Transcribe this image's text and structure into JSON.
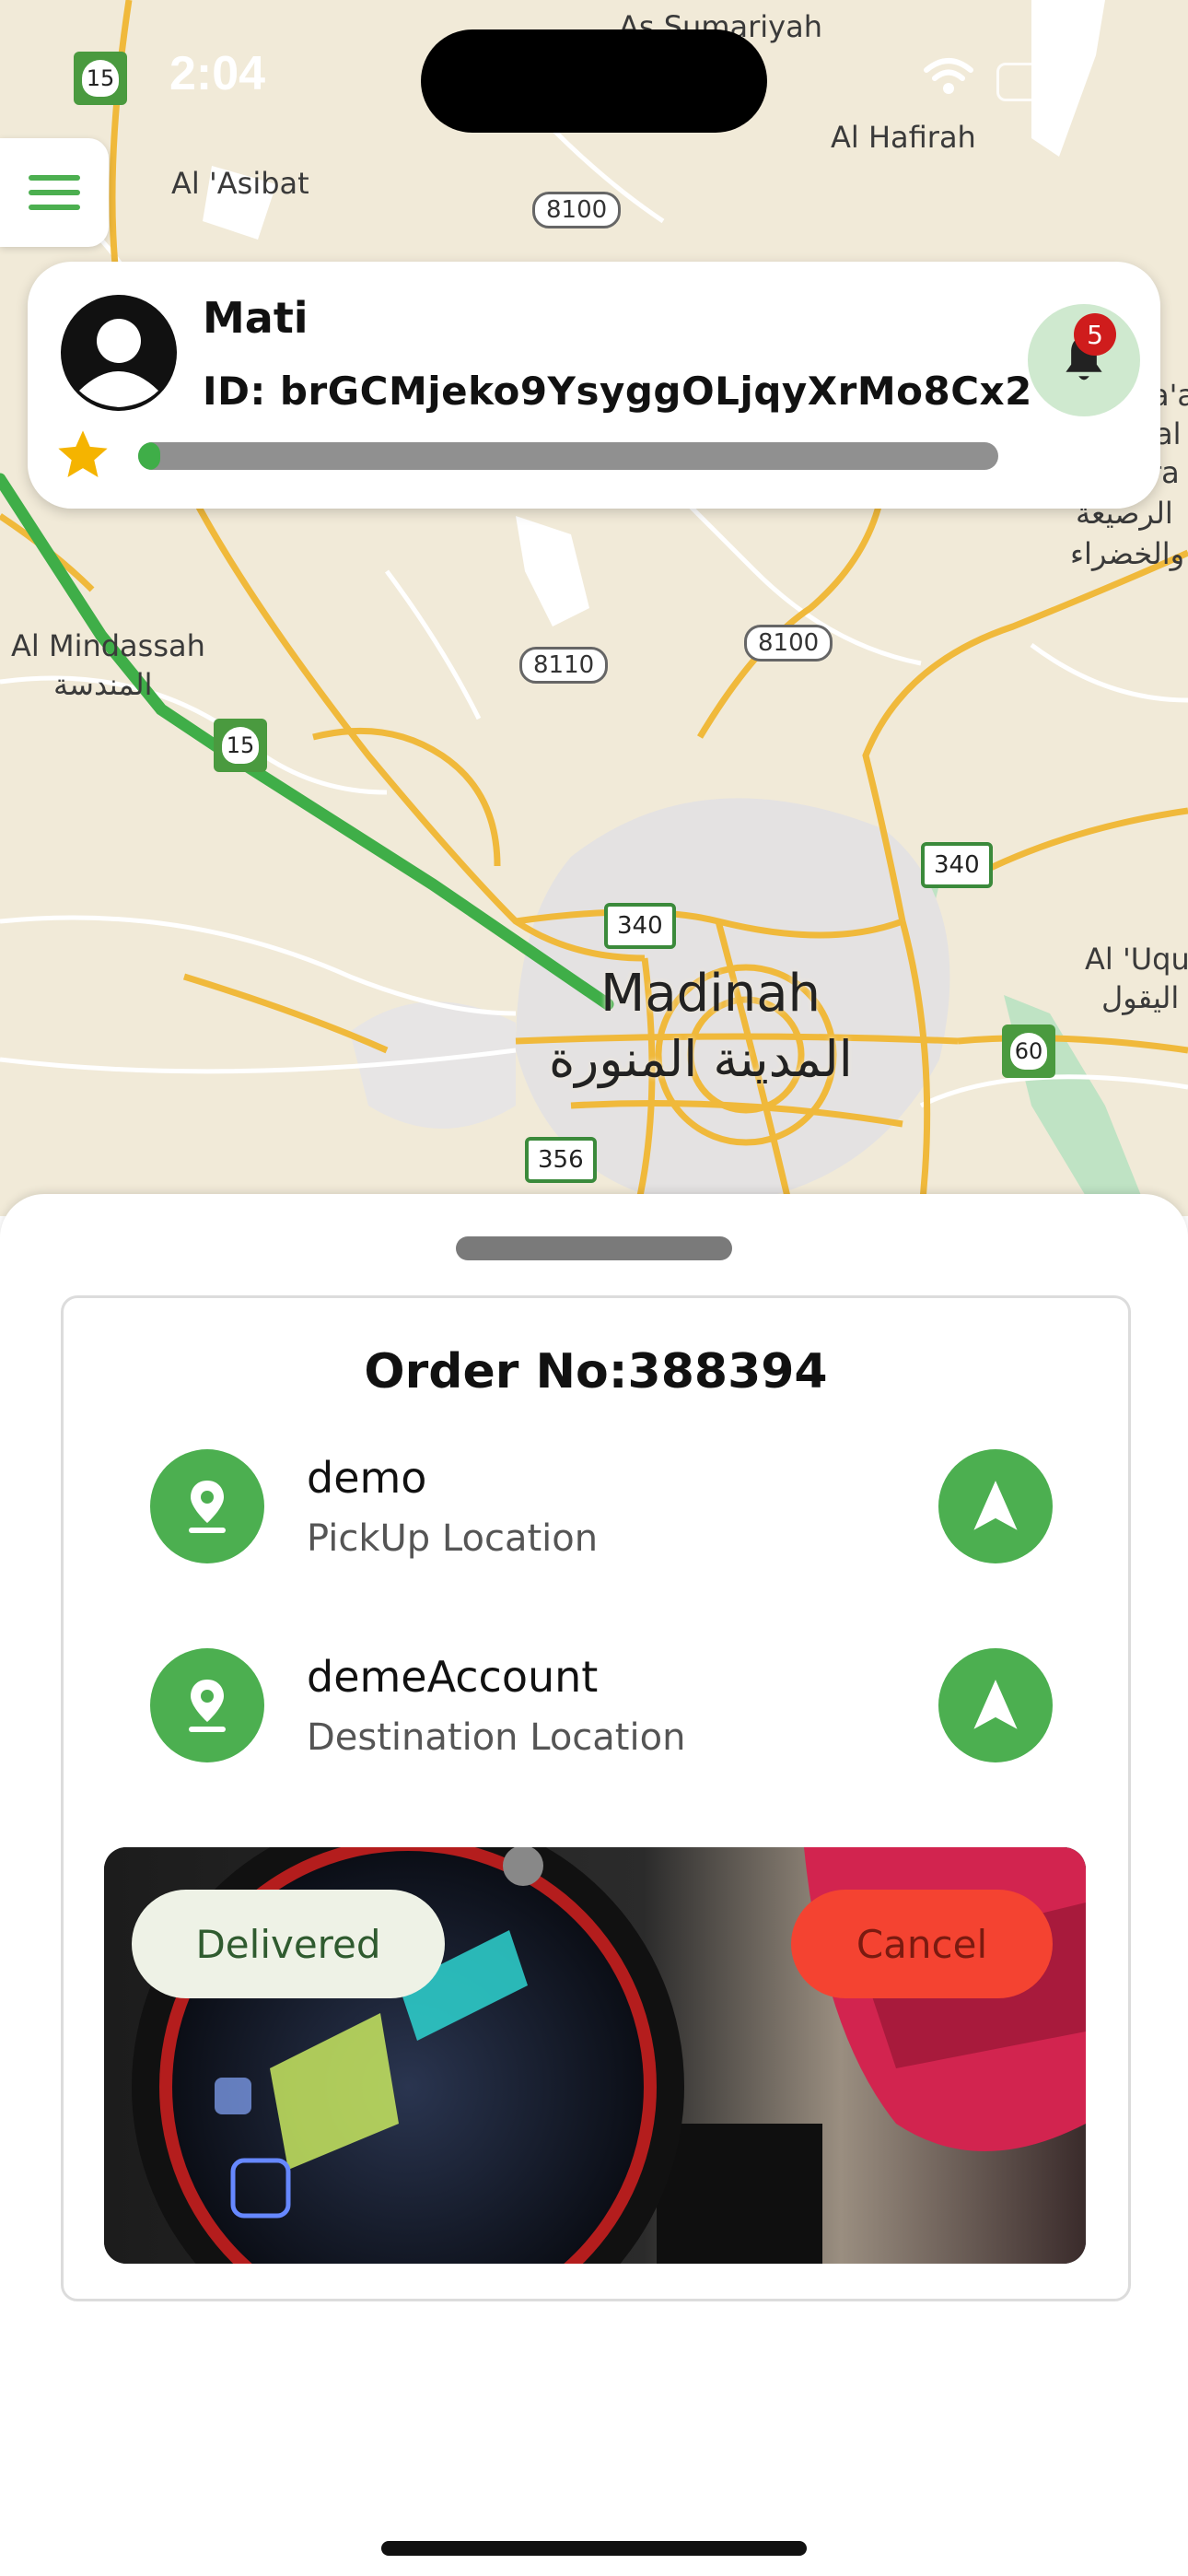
{
  "status_bar": {
    "time": "2:04"
  },
  "map": {
    "places": {
      "as_sumariyah": "As Sumariyah",
      "al_hafirah": "Al Hafirah",
      "al_asibat": "Al 'Asibat",
      "al_mindassah": "Al Mindassah",
      "al_mindassah_ar": "المندسة",
      "ar_rasiah_ar": "الرصيعة",
      "al_khadra_ar": "والخضراء",
      "right_a": "a'a",
      "right_l": "al",
      "right_ra": "ra",
      "al_uqul": "Al 'Uqu",
      "al_uqul_ar": "اليقول"
    },
    "city": {
      "name_en": "Madinah",
      "name_ar": "المدينة المنورة"
    },
    "roads": {
      "r8100a": "8100",
      "r8100b": "8100",
      "r8110": "8110",
      "r340a": "340",
      "r340b": "340",
      "r356": "356"
    },
    "shields": {
      "s15a": "15",
      "s15b": "15",
      "s60": "60"
    },
    "route_color": "#3fae48"
  },
  "profile": {
    "name": "Mati",
    "id_label": "ID: brGCMjeko9YsyggOLjqyXrMo8Cx2",
    "progress_fraction": 0.02,
    "notifications": "5"
  },
  "order": {
    "title": "Order No:388394",
    "pickup": {
      "name": "demo",
      "label": "PickUp Location"
    },
    "destination": {
      "name": "demeAccount",
      "label": "Destination Location"
    },
    "delivered_label": "Delivered",
    "cancel_label": "Cancel"
  },
  "colors": {
    "accent_green": "#4caf50",
    "cancel_red": "#f44331",
    "badge_red": "#cf1c1c"
  }
}
